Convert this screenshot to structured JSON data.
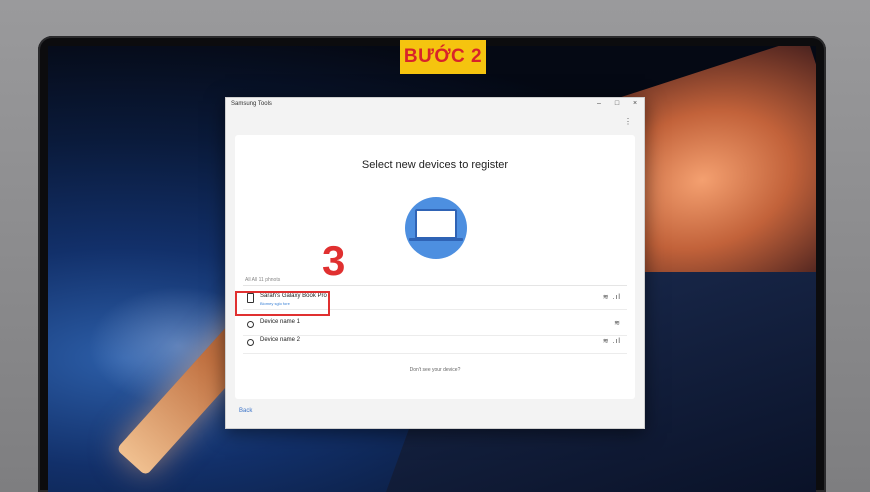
{
  "banner": {
    "step_label": "BƯỚC 2",
    "step_number": "3"
  },
  "window": {
    "title": "Samsung Tools",
    "controls": {
      "minimize": "–",
      "maximize": "□",
      "close": "×"
    },
    "menu": "⋮"
  },
  "main": {
    "heading": "Select new devices to register",
    "list_caption": "All All 11 phnots",
    "devices": [
      {
        "name": "Sarah's Galaxy Book Pro",
        "subtitle": "Biomey sglo fore",
        "signals": "≋ .ıl",
        "icon": "laptop-device-icon"
      },
      {
        "name": "Device name 1",
        "subtitle": "",
        "signals": "≋",
        "icon": "radio-icon"
      },
      {
        "name": "Device name 2",
        "subtitle": "",
        "signals": "≋ .ıl",
        "icon": "radio-icon"
      }
    ],
    "help_link": "Don't see your device?"
  },
  "footer": {
    "back_label": "Back"
  },
  "colors": {
    "badge_bg": "#f5c40f",
    "badge_text": "#d8232a",
    "highlight": "#e03030",
    "accent": "#3b73c8"
  }
}
